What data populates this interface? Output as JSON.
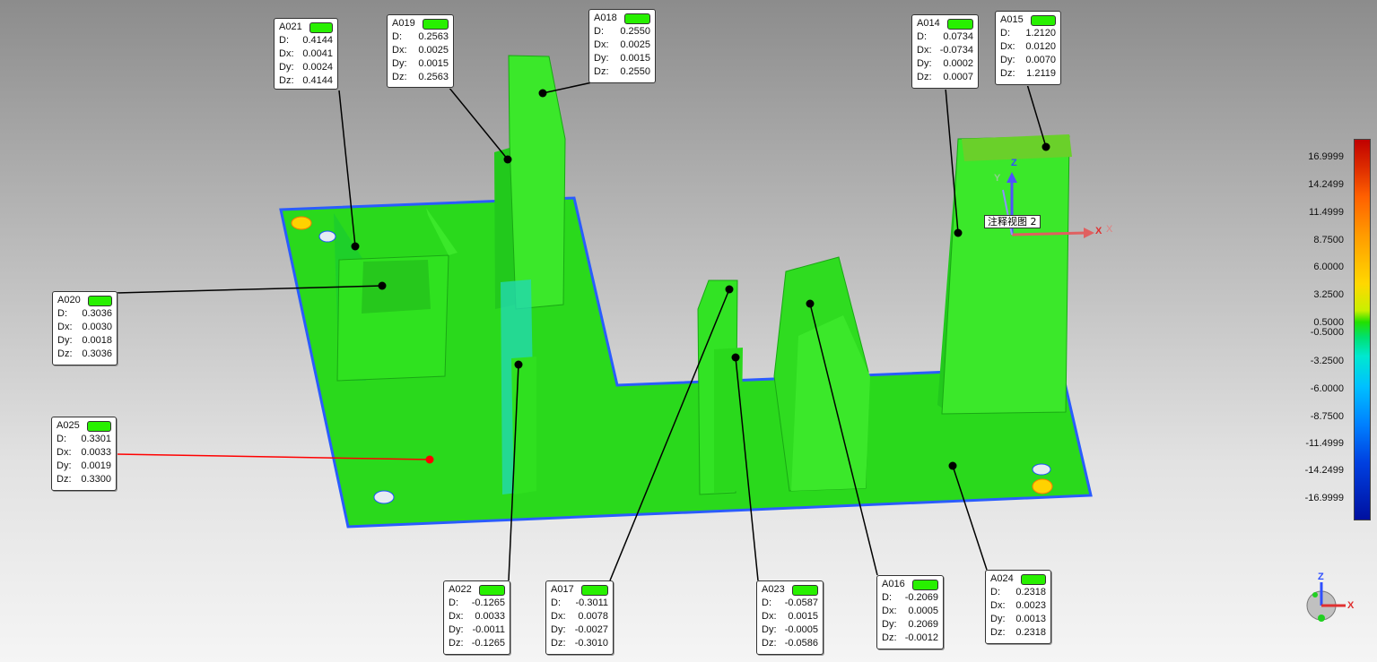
{
  "annotations": [
    {
      "id": "A021",
      "D": "0.4144",
      "Dx": "0.0041",
      "Dy": "0.0024",
      "Dz": "0.4144"
    },
    {
      "id": "A019",
      "D": "0.2563",
      "Dx": "0.0025",
      "Dy": "0.0015",
      "Dz": "0.2563"
    },
    {
      "id": "A018",
      "D": "0.2550",
      "Dx": "0.0025",
      "Dy": "0.0015",
      "Dz": "0.2550"
    },
    {
      "id": "A014",
      "D": "0.0734",
      "Dx": "-0.0734",
      "Dy": "0.0002",
      "Dz": "0.0007"
    },
    {
      "id": "A015",
      "D": "1.2120",
      "Dx": "0.0120",
      "Dy": "0.0070",
      "Dz": "1.2119"
    },
    {
      "id": "A020",
      "D": "0.3036",
      "Dx": "0.0030",
      "Dy": "0.0018",
      "Dz": "0.3036"
    },
    {
      "id": "A025",
      "D": "0.3301",
      "Dx": "0.0033",
      "Dy": "0.0019",
      "Dz": "0.3300"
    },
    {
      "id": "A022",
      "D": "-0.1265",
      "Dx": "0.0033",
      "Dy": "-0.0011",
      "Dz": "-0.1265"
    },
    {
      "id": "A017",
      "D": "-0.3011",
      "Dx": "0.0078",
      "Dy": "-0.0027",
      "Dz": "-0.3010"
    },
    {
      "id": "A023",
      "D": "-0.0587",
      "Dx": "0.0015",
      "Dy": "-0.0005",
      "Dz": "-0.0586"
    },
    {
      "id": "A016",
      "D": "-0.2069",
      "Dx": "0.0005",
      "Dy": "0.2069",
      "Dz": "-0.0012"
    },
    {
      "id": "A024",
      "D": "0.2318",
      "Dx": "0.0023",
      "Dy": "0.0013",
      "Dz": "0.2318"
    }
  ],
  "field_labels": {
    "D": "D:",
    "Dx": "Dx:",
    "Dy": "Dy:",
    "Dz": "Dz:"
  },
  "view_label": "注释视图 2",
  "axes": {
    "x": "X",
    "y": "Y",
    "z": "Z"
  },
  "colorbar_ticks": [
    "16.9999",
    "14.2499",
    "11.4999",
    "8.7500",
    "6.0000",
    "3.2500",
    "0.5000",
    "-0.5000",
    "-3.2500",
    "-6.0000",
    "-8.7500",
    "-11.4999",
    "-14.2499",
    "-16.9999"
  ],
  "colors": {
    "badge": "#28f000",
    "model": "#22e51a",
    "plate_edge": "#1e50ff",
    "leader_highlight": "#ff0000"
  }
}
